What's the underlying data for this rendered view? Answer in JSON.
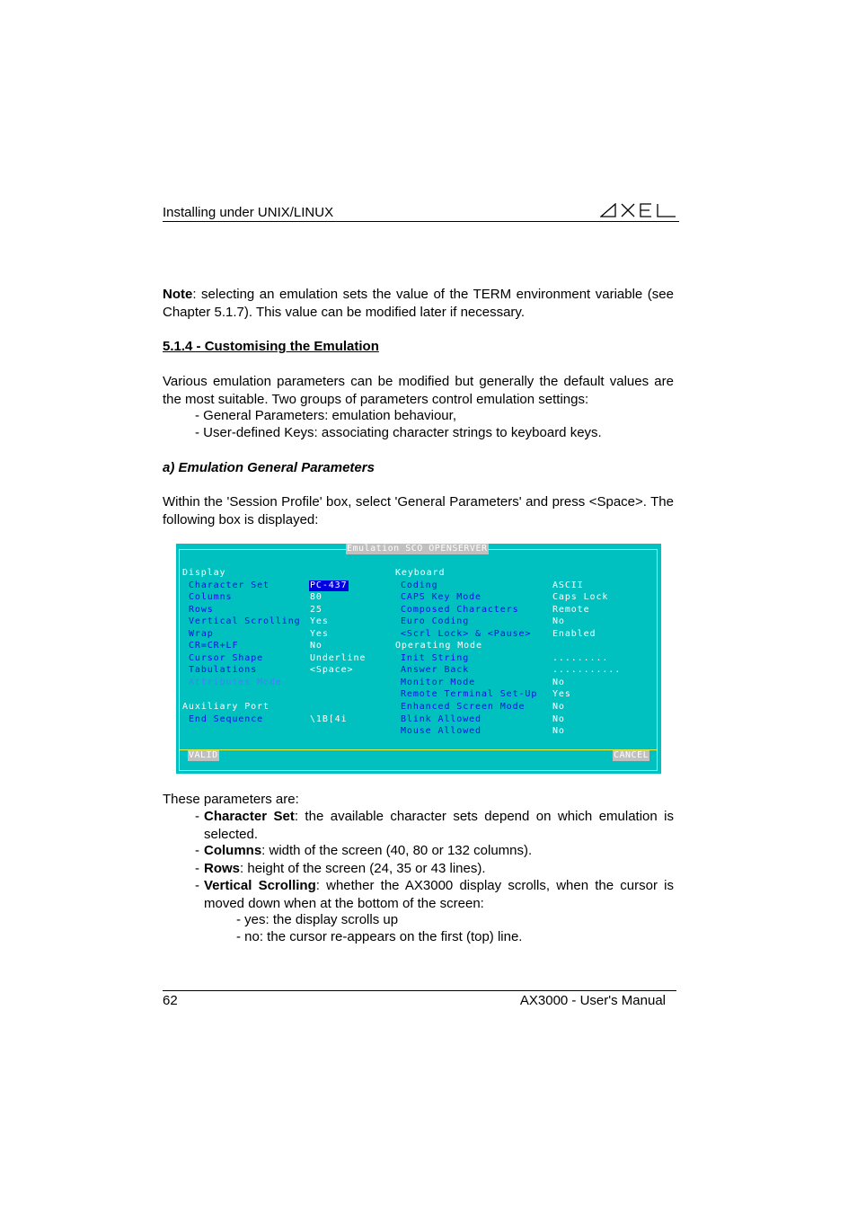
{
  "header": {
    "title": "Installing under UNIX/LINUX",
    "logo": "AXEL"
  },
  "note": {
    "label": "Note",
    "text": ": selecting an emulation sets the value of the TERM environment variable (see Chapter 5.1.7). This value can be modified later if necessary."
  },
  "section": {
    "heading": "5.1.4 - Customising the Emulation",
    "intro": "Various emulation parameters can be modified but generally the default values are the most suitable. Two groups of parameters control emulation settings:",
    "groups": [
      "- General Parameters: emulation behaviour,",
      "- User-defined Keys: associating character strings to keyboard keys."
    ]
  },
  "subsection": {
    "heading": "a) Emulation General Parameters",
    "text": "Within the 'Session Profile' box, select 'General Parameters' and press <Space>. The following box is displayed:"
  },
  "terminal": {
    "title": "Emulation SCO OPENSERVER",
    "left": {
      "display_heading": "Display",
      "display_items": [
        {
          "label": "Character Set",
          "value": "PC-437",
          "selected": true
        },
        {
          "label": "Columns",
          "value": "80"
        },
        {
          "label": "Rows",
          "value": "25"
        },
        {
          "label": "Vertical Scrolling",
          "value": "Yes"
        },
        {
          "label": "Wrap",
          "value": "Yes"
        },
        {
          "label": "CR=CR+LF",
          "value": "No"
        },
        {
          "label": "Cursor Shape",
          "value": "Underline"
        },
        {
          "label": "Tabulations",
          "value": "<Space>"
        },
        {
          "label": "Attributes Mode",
          "value": "",
          "disabled": true
        }
      ],
      "aux_heading": "Auxiliary Port",
      "aux_items": [
        {
          "label": "End Sequence",
          "value": "\\1B[4i"
        }
      ]
    },
    "right": {
      "keyboard_heading": "Keyboard",
      "keyboard_items": [
        {
          "label": "Coding",
          "value": "ASCII"
        },
        {
          "label": "CAPS Key Mode",
          "value": "Caps Lock"
        },
        {
          "label": "Composed Characters",
          "value": "Remote"
        },
        {
          "label": "Euro Coding",
          "value": "No"
        },
        {
          "label": "<Scrl Lock> & <Pause>",
          "value": "Enabled"
        }
      ],
      "operating_heading": "Operating Mode",
      "operating_items": [
        {
          "label": "Init String",
          "value": "........."
        },
        {
          "label": "Answer Back",
          "value": "..........."
        },
        {
          "label": "Monitor Mode",
          "value": "No"
        },
        {
          "label": "Remote Terminal Set-Up",
          "value": "Yes"
        },
        {
          "label": "Enhanced Screen Mode",
          "value": "No"
        },
        {
          "label": "Blink Allowed",
          "value": "No"
        },
        {
          "label": "Mouse Allowed",
          "value": "No"
        }
      ]
    },
    "buttons": {
      "valid": "VALID",
      "cancel": "CANCEL"
    },
    "colors": {
      "background": "#00c0c0",
      "frame": "#e8f040",
      "label": "#1010e0",
      "value": "#ffffff",
      "selected_bg": "#0000e0",
      "button_bg": "#c0c0c0"
    }
  },
  "parameters": {
    "intro": "These parameters are:",
    "items": [
      {
        "term": "Character Set",
        "desc": ": the available character sets depend on which emulation is selected."
      },
      {
        "term": "Columns",
        "desc": ": width of the screen (40, 80 or 132 columns)."
      },
      {
        "term": "Rows",
        "desc": ": height of the screen (24, 35 or 43 lines)."
      },
      {
        "term": "Vertical Scrolling",
        "desc": ": whether the AX3000 display scrolls, when the cursor is moved down when at the bottom of the screen:"
      }
    ],
    "scroll_options": [
      "- yes: the display scrolls up",
      "- no: the cursor re-appears on the first (top) line."
    ]
  },
  "footer": {
    "page": "62",
    "title": "AX3000 - User's Manual"
  }
}
